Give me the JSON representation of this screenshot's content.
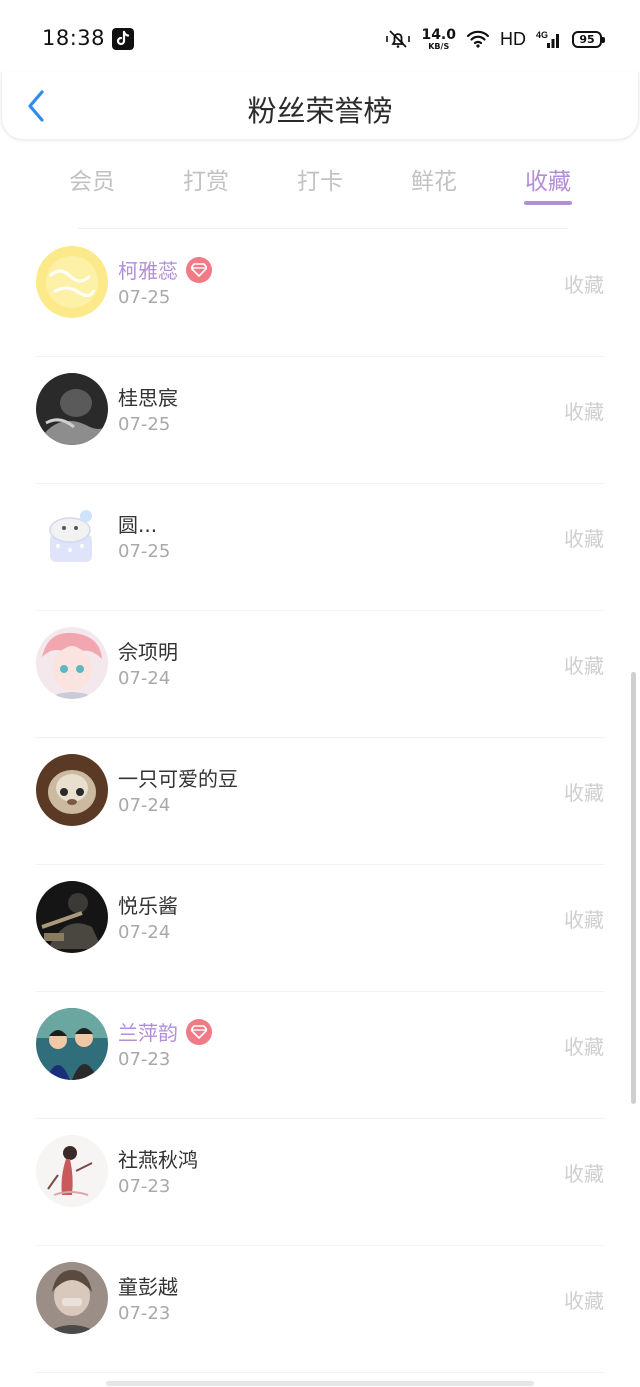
{
  "status_bar": {
    "time": "18:38",
    "net_speed": "14.0",
    "net_unit": "KB/S",
    "hd": "HD",
    "network": "4G",
    "battery": "95"
  },
  "header": {
    "title": "粉丝荣誉榜"
  },
  "tabs": [
    {
      "label": "会员",
      "active": false
    },
    {
      "label": "打赏",
      "active": false
    },
    {
      "label": "打卡",
      "active": false
    },
    {
      "label": "鲜花",
      "active": false
    },
    {
      "label": "收藏",
      "active": true
    }
  ],
  "fans": [
    {
      "name": "柯雅蕊",
      "date": "07-25",
      "action": "收藏",
      "vip": true
    },
    {
      "name": "桂思宸",
      "date": "07-25",
      "action": "收藏",
      "vip": false
    },
    {
      "name": "圆...",
      "date": "07-25",
      "action": "收藏",
      "vip": false
    },
    {
      "name": "佘项明",
      "date": "07-24",
      "action": "收藏",
      "vip": false
    },
    {
      "name": "一只可爱的豆",
      "date": "07-24",
      "action": "收藏",
      "vip": false
    },
    {
      "name": "悦乐酱",
      "date": "07-24",
      "action": "收藏",
      "vip": false
    },
    {
      "name": "兰萍韵",
      "date": "07-23",
      "action": "收藏",
      "vip": true
    },
    {
      "name": "社燕秋鸿",
      "date": "07-23",
      "action": "收藏",
      "vip": false
    },
    {
      "name": "童彭越",
      "date": "07-23",
      "action": "收藏",
      "vip": false
    }
  ],
  "colors": {
    "accent": "#b38ed8",
    "vip_badge": "#f07a85",
    "back_arrow": "#2d8cf0"
  }
}
